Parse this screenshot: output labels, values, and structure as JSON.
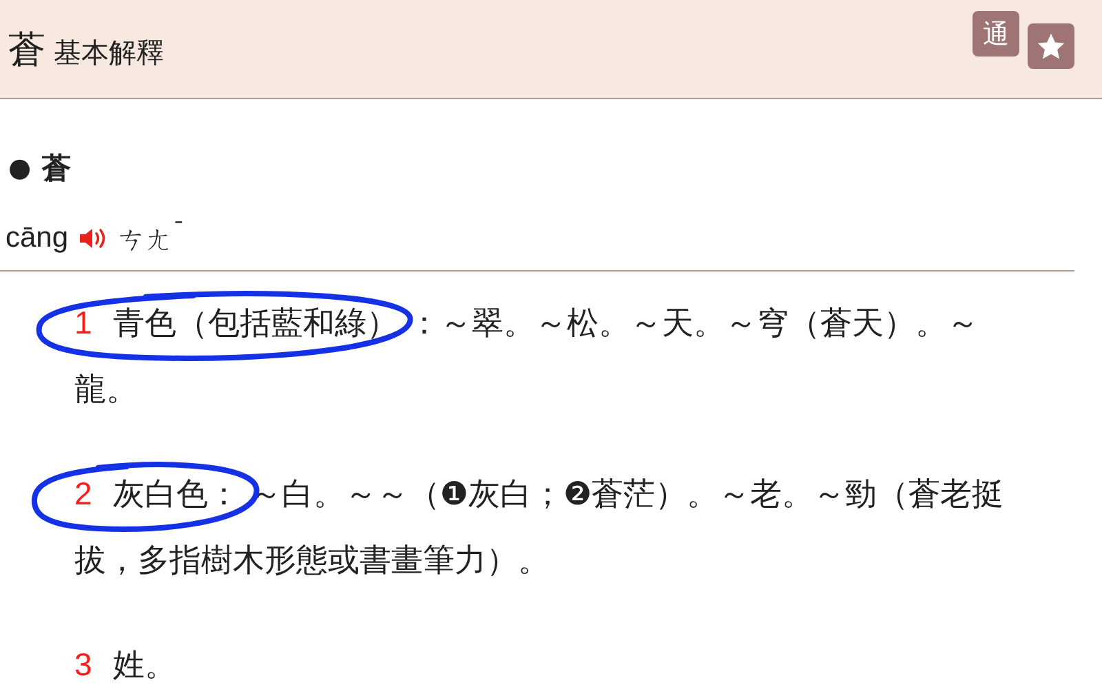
{
  "header": {
    "character": "蒼",
    "title": "基本解釋",
    "buttons": [
      {
        "kind": "text",
        "label": "通"
      },
      {
        "kind": "star"
      }
    ]
  },
  "entry": {
    "bullet": "●",
    "character": "蒼",
    "pinyin": "cāng",
    "zhuyin": "ㄘㄤ$^{ˉ}$"
  },
  "definitions": [
    {
      "number": "1",
      "head": "青色（包括藍和綠）",
      "lines": [
        "：～翠。～松。～天。～穹（蒼天）。～",
        "龍。"
      ],
      "highlighted": true
    },
    {
      "number": "2",
      "head": "灰白色：",
      "lines": [
        "～白。～～（❶灰白；❷蒼茫）。～老。～勁（蒼老挺",
        "拔，多指樹木形態或書畫筆力）。"
      ],
      "highlighted": true
    },
    {
      "number": "3",
      "head": "姓。",
      "highlighted": false
    }
  ]
}
